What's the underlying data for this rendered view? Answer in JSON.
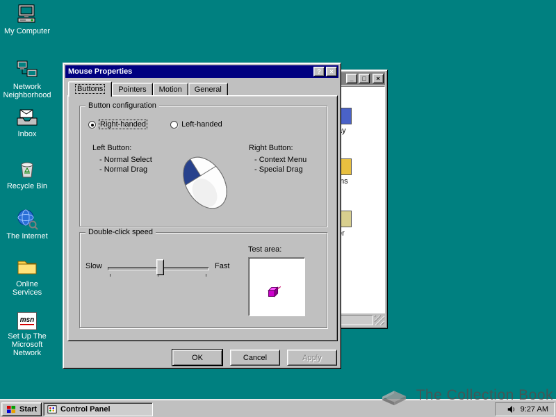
{
  "colors": {
    "desktop": "#008080",
    "titlebar_active": "#000080",
    "titlebar_inactive": "#808080",
    "chrome": "#c0c0c0"
  },
  "desktop": {
    "icons": [
      {
        "label": "My Computer"
      },
      {
        "label": "Network Neighborhood"
      },
      {
        "label": "Inbox"
      },
      {
        "label": "Recycle Bin"
      },
      {
        "label": "The Internet"
      },
      {
        "label": "Online Services"
      },
      {
        "label": "Set Up The Microsoft Network",
        "icon_text": "msn"
      }
    ]
  },
  "dialog": {
    "title": "Mouse Properties",
    "controls": {
      "help": "?",
      "close": "×"
    },
    "tabs": [
      {
        "label": "Buttons"
      },
      {
        "label": "Pointers"
      },
      {
        "label": "Motion"
      },
      {
        "label": "General"
      }
    ],
    "button_config": {
      "group_label": "Button configuration",
      "radio_right": "Right-handed",
      "radio_left": "Left-handed",
      "left_title": "Left Button:",
      "left_items": [
        "- Normal Select",
        "- Normal Drag"
      ],
      "right_title": "Right Button:",
      "right_items": [
        "- Context Menu",
        "- Special Drag"
      ]
    },
    "double_click": {
      "group_label": "Double-click speed",
      "slow": "Slow",
      "fast": "Fast",
      "test_area_label": "Test area:"
    },
    "action_buttons": {
      "ok": "OK",
      "cancel": "Cancel",
      "apply": "Apply"
    }
  },
  "background_window": {
    "controls": {
      "minimize": "_",
      "maximize": "□",
      "close": "×"
    },
    "partial_labels": [
      "ay",
      "ms",
      "er"
    ]
  },
  "taskbar": {
    "start": "Start",
    "task": "Control Panel",
    "clock": "9:27 AM"
  },
  "watermark": "The Collection Book"
}
